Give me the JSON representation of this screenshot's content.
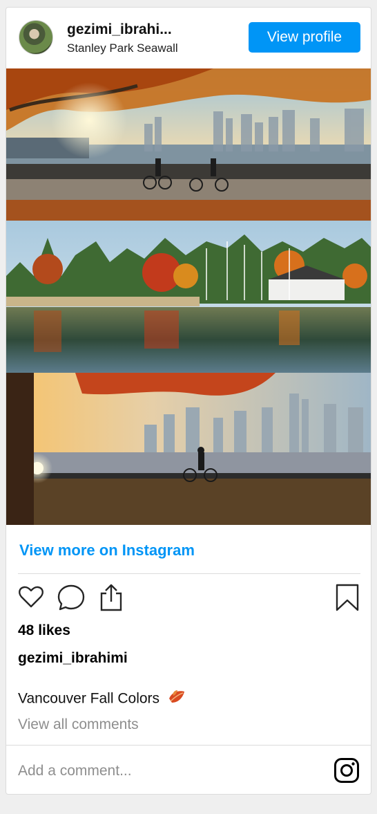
{
  "header": {
    "username": "gezimi_ibrahi...",
    "location": "Stanley Park Seawall",
    "view_profile_label": "View profile"
  },
  "footer": {
    "view_more_label": "View more on Instagram",
    "likes_text": "48 likes",
    "owner_username": "gezimi_ibrahimi",
    "caption_text": "Vancouver Fall Colors",
    "view_all_comments_label": "View all comments",
    "comment_placeholder": "Add a comment..."
  },
  "icons": {
    "like": "heart-icon",
    "comment": "comment-bubble-icon",
    "share": "share-icon",
    "save": "bookmark-icon",
    "caption_emoji": "fallen-leaf-emoji",
    "brand": "instagram-icon"
  },
  "colors": {
    "accent": "#0095f6",
    "muted_text": "#8e8e8e",
    "border": "#dbdbdb"
  }
}
